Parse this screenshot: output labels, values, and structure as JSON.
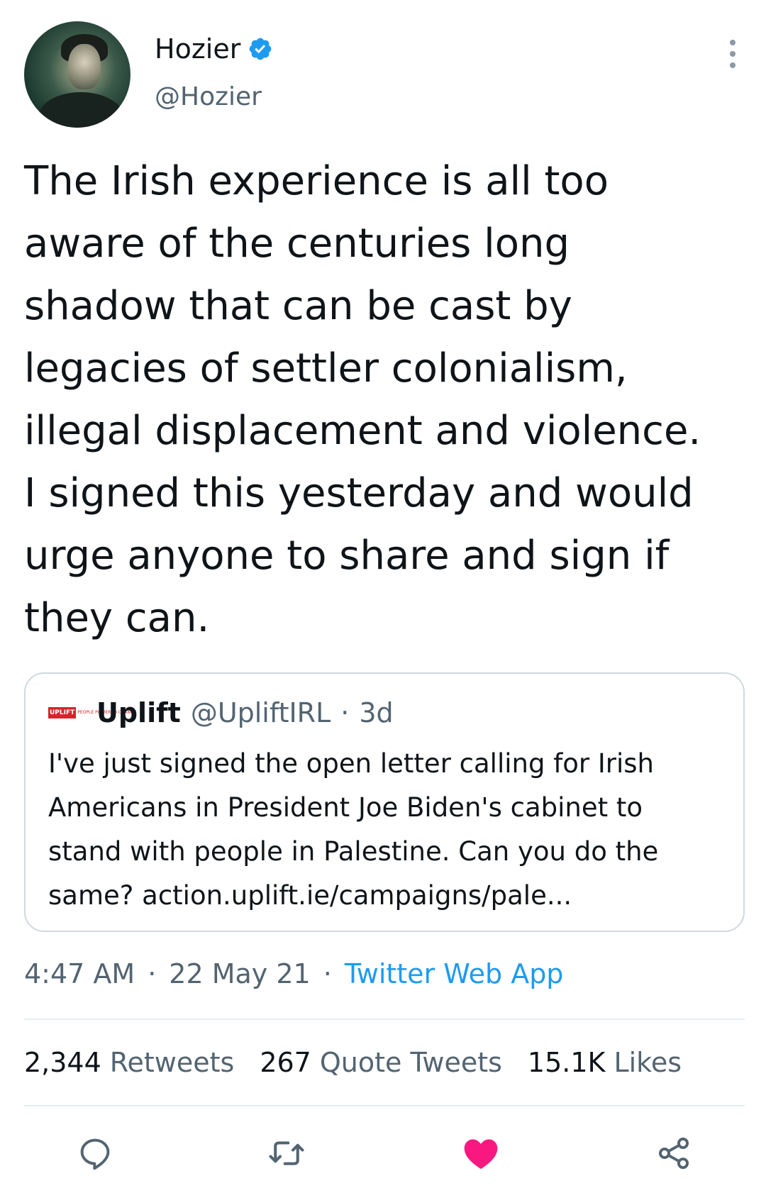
{
  "author": {
    "display_name": "Hozier",
    "handle": "@Hozier",
    "verified": true
  },
  "tweet": {
    "text_lines": [
      "The Irish experience is all too",
      "aware of the centuries long",
      "shadow that can be cast by",
      "legacies of settler colonialism,",
      "illegal displacement and violence.",
      "I signed this yesterday and would",
      "urge anyone to share and sign if",
      "they can."
    ]
  },
  "quoted": {
    "logo_text": "UPLIFT",
    "logo_small_text": "PEOPLE POWERED CHANGE",
    "name": "Uplift",
    "handle": "@UpliftIRL",
    "separator": "·",
    "time": "3d",
    "text_lines": [
      "I've just signed the open letter calling for Irish",
      "Americans in President Joe Biden's cabinet to",
      "stand with people in Palestine. Can you do the",
      "same?  action.uplift.ie/campaigns/pale..."
    ]
  },
  "meta": {
    "time": "4:47 AM",
    "separator": "·",
    "date": "22 May 21",
    "source": "Twitter Web App"
  },
  "stats": {
    "retweets_count": "2,344",
    "retweets_label": "Retweets",
    "quotes_count": "267",
    "quotes_label": "Quote Tweets",
    "likes_count": "15.1K",
    "likes_label": "Likes"
  },
  "colors": {
    "text": "#0f1419",
    "secondary": "#536471",
    "link": "#1d9bf0",
    "verified": "#1d9bf0",
    "like_active": "#f91880",
    "border": "#cfd9de"
  },
  "icons": [
    "more-vertical-icon",
    "verified-badge-icon",
    "reply-icon",
    "retweet-icon",
    "like-heart-icon",
    "share-icon"
  ]
}
